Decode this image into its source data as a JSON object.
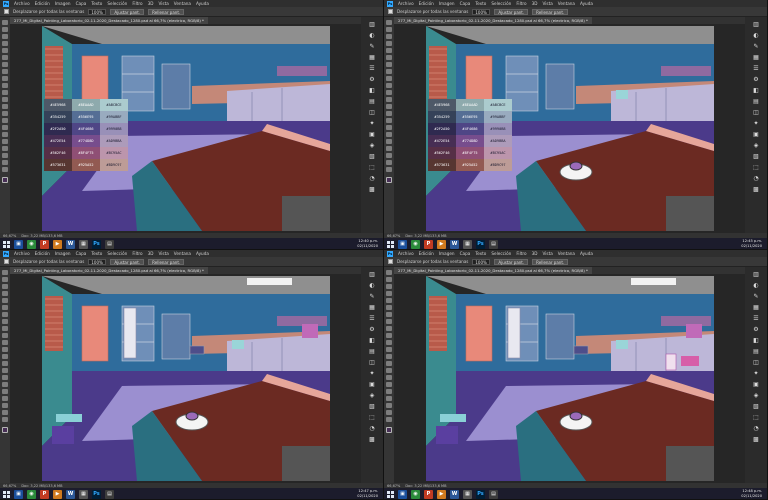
{
  "menu": [
    "Archivo",
    "Edición",
    "Imagen",
    "Capa",
    "Texto",
    "Selección",
    "Filtro",
    "3D",
    "Vista",
    "Ventana",
    "Ayuda"
  ],
  "options": {
    "scroll_all_windows": "Desplazarse por todas las ventanas",
    "zoom": "100%",
    "fit_screen": "Ajustar pant.",
    "fill_screen": "Rellenar pant."
  },
  "doc_tab": "277_Mi_Digital_Painting_Laboratorio_02-11-2020_Destacado_1280.psd al 66,7% (electrico, RGB/8) *",
  "status": {
    "zoom": "66,67%",
    "doc": "Doc: 3,22 MB/133,6 MB"
  },
  "panes": [
    {
      "time": "12:40 p.m.",
      "date": "02/11/2020",
      "show_swatches": true,
      "stage": 1
    },
    {
      "time": "12:45 p.m.",
      "date": "02/11/2020",
      "show_swatches": true,
      "stage": 2
    },
    {
      "time": "12:47 p.m.",
      "date": "02/11/2020",
      "show_swatches": false,
      "stage": 3
    },
    {
      "time": "12:48 p.m.",
      "date": "02/11/2020",
      "show_swatches": false,
      "stage": 4
    }
  ],
  "swatches": [
    [
      "#4E5968",
      "#8EAAAD",
      "#ABCBCE"
    ],
    [
      "#354259",
      "#556E95",
      "#99ABBF"
    ],
    [
      "#2F2A50",
      "#4F4686",
      "#9990B8"
    ],
    [
      "#472E54",
      "#774D8D",
      "#AD9BBA"
    ],
    [
      "#562F46",
      "#8F4F75",
      "#BC95AC"
    ],
    [
      "#573631",
      "#925A52",
      "#BD9C97"
    ]
  ],
  "colors": {
    "ui_dark": "#282828",
    "ps_blue": "#31a8ff",
    "wall_blue": "#2f6c9c",
    "wall_teal": "#3a8b8f",
    "floor_purple": "#4b3a8a",
    "floor_lavender": "#9b8fd0",
    "counter_brown": "#6b2a22",
    "accent_pink": "#e8897a"
  }
}
